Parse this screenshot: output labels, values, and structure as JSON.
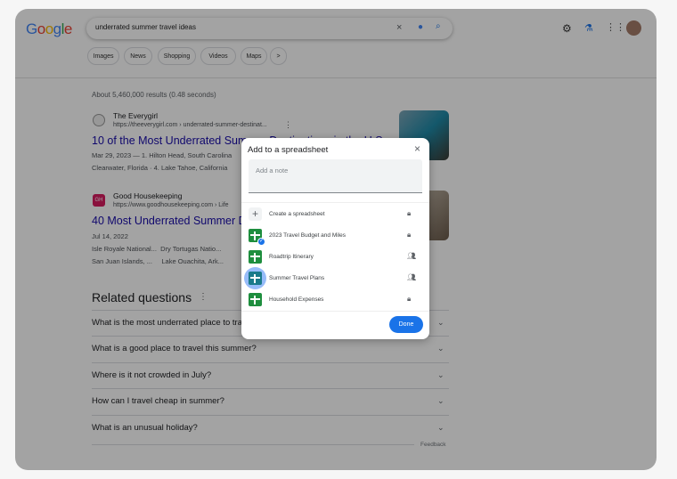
{
  "header": {
    "search_query": "underrated summer travel ideas",
    "chips": [
      "Images",
      "News",
      "Shopping",
      "Videos",
      "Maps",
      ">"
    ]
  },
  "results_count": "About 5,460,000 results (0.48 seconds)",
  "results": [
    {
      "site": "The Everygirl",
      "url": "https://theeverygirl.com › underrated-summer-destinat...",
      "title": "10 of the Most Underrated Summer Destinations in the U.S.",
      "snippet1": "Mar 29, 2023 — 1. Hilton Head, South Carolina",
      "snippet2": "Clearwater, Florida · 4. Lake Tahoe, California"
    },
    {
      "site": "Good Housekeeping",
      "favicon_text": "GH",
      "url": "https://www.goodhousekeeping.com › Life",
      "title": "40 Most Underrated Summer Destinations",
      "snippet1": "Jul 14, 2022",
      "snippet2": "Isle Royale National...  Dry Tortugas Natio...",
      "snippet3": "San Juan Islands, ...     Lake Ouachita, Ark..."
    }
  ],
  "related": {
    "heading": "Related questions",
    "questions": [
      "What is the most underrated place to travel?",
      "What is a good place to travel this summer?",
      "Where is it not crowded in July?",
      "How can I travel cheap in summer?",
      "What is an unusual holiday?"
    ],
    "feedback": "Feedback"
  },
  "dialog": {
    "title": "Add to a spreadsheet",
    "note_placeholder": "Add a note",
    "create_label": "Create a spreadsheet",
    "items": [
      {
        "label": "2023 Travel Budget and Miles",
        "access": "private",
        "checked": true
      },
      {
        "label": "Roadtrip Itinerary",
        "access": "shared"
      },
      {
        "label": "Summer Travel Plans",
        "access": "shared",
        "hovered": true
      },
      {
        "label": "Household Expenses",
        "access": "private"
      }
    ],
    "done_label": "Done"
  },
  "colors": {
    "link": "#1a0dab",
    "accent": "#1a73e8",
    "sheets": "#1e8e3e"
  }
}
